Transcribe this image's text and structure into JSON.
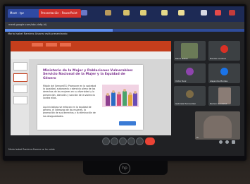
{
  "browser": {
    "tabs": [
      {
        "label": "Meet - tpc"
      },
      {
        "label": "Presentación - PowerPoint"
      }
    ],
    "url": "meet.google.com/abc-defg-hij",
    "progress": 0.45
  },
  "meeting": {
    "title": "Maria Isabel Ramirez Alvarez está presentando",
    "footer_label": "Maria Isabel Ramirez Alvarez se ha unido",
    "slide": {
      "title": "Ministerio de la Mujer y Poblaciones Vulnerables: Servicio Nacional de la Mujer y la Equidad de Género",
      "paragraph_1": "Misión del SernamEG: Promover en la sociedad la igualdad, autonomía y ejercicio pleno de los derechos de las mujeres en su diversidad y la prevención, atención y sanción de la violencia contra ellas.",
      "paragraph_2": "Las iniciativas se enfocan en la equidad de género, el liderazgo de las mujeres, la promoción de sus derechos y la eliminación de las desigualdades."
    }
  },
  "participants": [
    {
      "name": "Maria Isabel",
      "color": "#6b7b57"
    },
    {
      "name": "Denise Cordova",
      "color": "#d93025"
    },
    {
      "name": "Victor Ruiz",
      "color": "#8e44ad"
    },
    {
      "name": "Alejandra Montes",
      "color": "#1a73e8"
    },
    {
      "name": "Gabriela Hernandez",
      "color": "#7d6b45"
    },
    {
      "name": "Ramon Gonzalez",
      "color": "#8a7c75"
    },
    {
      "name": "Tu",
      "color": "#5f5a56"
    }
  ],
  "controls": [
    "mic-icon",
    "camera-icon",
    "present-icon",
    "raise-hand-icon",
    "more-icon",
    "end-call-icon"
  ],
  "brand": "hp"
}
